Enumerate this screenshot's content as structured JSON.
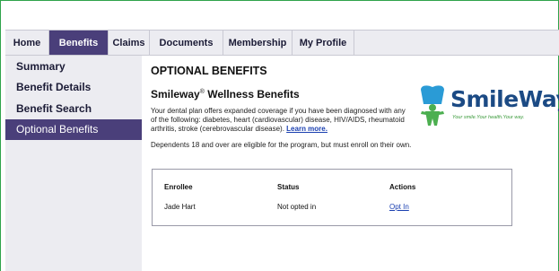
{
  "nav": {
    "tabs": [
      {
        "label": "Home"
      },
      {
        "label": "Benefits"
      },
      {
        "label": "Claims"
      },
      {
        "label": "Documents"
      },
      {
        "label": "Membership"
      },
      {
        "label": "My Profile"
      }
    ],
    "active_tab": "Benefits"
  },
  "sidebar": {
    "items": [
      {
        "label": "Summary"
      },
      {
        "label": "Benefit Details"
      },
      {
        "label": "Benefit Search"
      },
      {
        "label": "Optional Benefits"
      }
    ],
    "active_item": "Optional Benefits"
  },
  "main": {
    "page_title": "OPTIONAL BENEFITS",
    "subtitle_brand": "Smileway",
    "subtitle_mark": "®",
    "subtitle_rest": " Wellness Benefits",
    "description": "Your dental plan offers expanded coverage if you have been diagnosed with any of the following: diabetes, heart (cardiovascular) disease, HIV/AIDS, rheumatoid arthritis, stroke (cerebrovascular disease). ",
    "learn_more_label": "Learn more.",
    "note": "Dependents 18 and over are eligible for the program, but must enroll on their own."
  },
  "logo": {
    "wordmark": "SmileWay",
    "registered": "®",
    "tagline": "Your smile.Your health.Your way."
  },
  "enrollment_table": {
    "headers": [
      "Enrollee",
      "Status",
      "Actions"
    ],
    "rows": [
      {
        "enrollee": "Jade Hart",
        "status": "Not opted in",
        "action": "Opt In"
      }
    ]
  },
  "colors": {
    "accent_purple": "#4a3f7a",
    "nav_bg": "#ececf1",
    "link_blue": "#1a3fb0",
    "logo_blue": "#1b4a84",
    "logo_green": "#4caf50",
    "frame_green": "#2fa34a"
  }
}
